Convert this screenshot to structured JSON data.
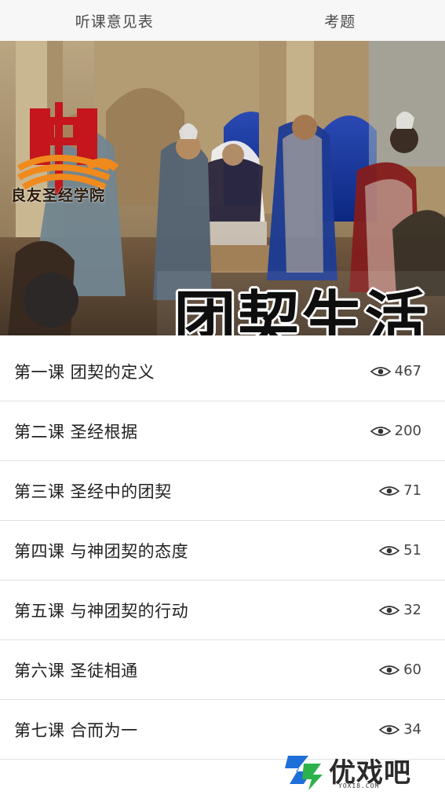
{
  "tabs": {
    "left_label": "听课意见表",
    "right_label": "考题"
  },
  "banner": {
    "title": "团契生活",
    "logo_text": "良友圣经学院"
  },
  "lessons": [
    {
      "title": "第一课 团契的定义",
      "views": "467"
    },
    {
      "title": "第二课 圣经根据",
      "views": "200"
    },
    {
      "title": "第三课 圣经中的团契",
      "views": "71"
    },
    {
      "title": "第四课 与神团契的态度",
      "views": "51"
    },
    {
      "title": "第五课 与神团契的行动",
      "views": "32"
    },
    {
      "title": "第六课 圣徒相通",
      "views": "60"
    },
    {
      "title": "第七课 合而为一",
      "views": "34"
    }
  ],
  "watermark": {
    "text": "优戏吧",
    "sub": "YOXI8.COM"
  },
  "colors": {
    "tab_bar_bg": "#f7f7f7",
    "divider": "#e2e2e2",
    "logo_red": "#c4161c",
    "logo_orange": "#f08a1c",
    "watermark_blue": "#1e6fd9",
    "watermark_green": "#2bb24c"
  },
  "icons": {
    "view_count": "eye-icon"
  }
}
